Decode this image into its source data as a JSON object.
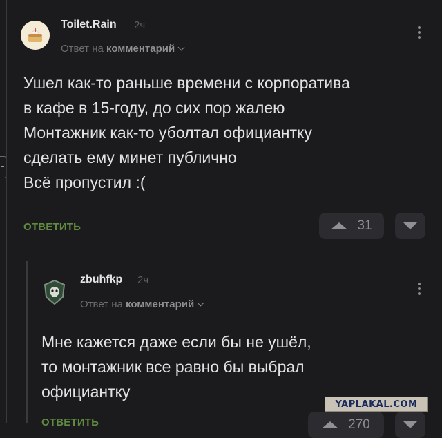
{
  "comment1": {
    "username": "Toilet.Rain",
    "time": "2ч",
    "reply_prefix": "Ответ на",
    "reply_target": "комментарий",
    "text": "Ушел как-то раньше времени с корпоратива\nв кафе в 15-году, до сих пор жалею\nМонтажник как-то уболтал официантку\nсделать ему минет публично\nВсё пропустил :(",
    "reply_label": "ОТВЕТИТЬ",
    "votes": "31"
  },
  "comment2": {
    "username": "zbuhfkp",
    "time": "2ч",
    "reply_prefix": "Ответ на",
    "reply_target": "комментарий",
    "text": "Мне кажется даже если бы не ушёл,\nто монтажник все равно бы выбрал\nофициантку",
    "reply_label": "ОТВЕТИТЬ",
    "votes": "270"
  },
  "watermark": "YAPLAKAL.COM",
  "colors": {
    "background": "#1b1b1d",
    "accent_green": "#5f8a3f",
    "vote_box": "#2c2c30"
  },
  "icons": [
    "avatar-cake",
    "avatar-emblem",
    "kebab-menu-icon",
    "chevron-down-icon",
    "upvote-icon",
    "downvote-icon"
  ]
}
